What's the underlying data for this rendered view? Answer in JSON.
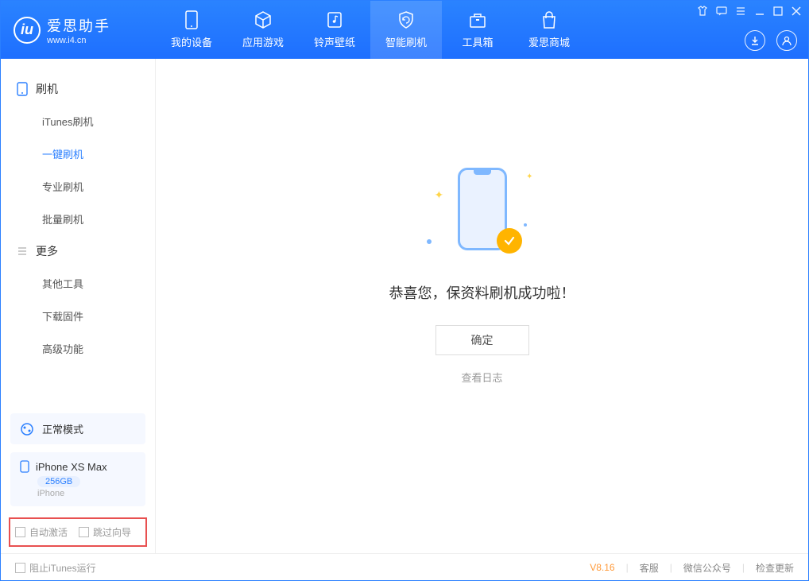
{
  "app": {
    "title": "爱思助手",
    "subtitle": "www.i4.cn"
  },
  "nav": {
    "items": [
      {
        "label": "我的设备"
      },
      {
        "label": "应用游戏"
      },
      {
        "label": "铃声壁纸"
      },
      {
        "label": "智能刷机"
      },
      {
        "label": "工具箱"
      },
      {
        "label": "爱思商城"
      }
    ]
  },
  "sidebar": {
    "section1": {
      "title": "刷机",
      "items": [
        {
          "label": "iTunes刷机"
        },
        {
          "label": "一键刷机"
        },
        {
          "label": "专业刷机"
        },
        {
          "label": "批量刷机"
        }
      ]
    },
    "section2": {
      "title": "更多",
      "items": [
        {
          "label": "其他工具"
        },
        {
          "label": "下载固件"
        },
        {
          "label": "高级功能"
        }
      ]
    },
    "mode": "正常模式",
    "device": {
      "name": "iPhone XS Max",
      "capacity": "256GB",
      "type": "iPhone"
    },
    "opts": {
      "auto_activate": "自动激活",
      "skip_guide": "跳过向导"
    }
  },
  "main": {
    "success_text": "恭喜您，保资料刷机成功啦！",
    "ok_button": "确定",
    "view_log": "查看日志"
  },
  "footer": {
    "block_itunes": "阻止iTunes运行",
    "version": "V8.16",
    "support": "客服",
    "wechat": "微信公众号",
    "check_update": "检查更新"
  }
}
